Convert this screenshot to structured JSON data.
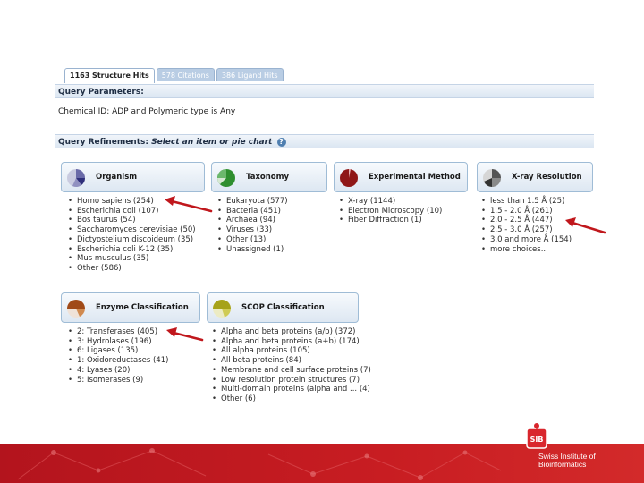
{
  "tabs": [
    {
      "label": "1163 Structure Hits",
      "active": true
    },
    {
      "label": "578 Citations",
      "active": false
    },
    {
      "label": "386 Ligand Hits",
      "active": false
    }
  ],
  "query": {
    "header": "Query Parameters:",
    "text": "Chemical ID: ADP and Polymeric type is Any"
  },
  "refinements": {
    "header_bold": "Query Refinements:",
    "header_italic": "Select an item or pie chart",
    "help_glyph": "?"
  },
  "facets": [
    {
      "title": "Organism",
      "pie_colors": [
        "#3f3f8f",
        "#c9cbe0"
      ],
      "items": [
        "Homo sapiens (254)",
        "Escherichia coli (107)",
        "Bos taurus (54)",
        "Saccharomyces cerevisiae (50)",
        "Dictyostelium discoideum (35)",
        "Escherichia coli K-12 (35)",
        "Mus musculus (35)",
        "Other (586)"
      ]
    },
    {
      "title": "Taxonomy",
      "pie_colors": [
        "#2f8f2f",
        "#d7e8d3"
      ],
      "items": [
        "Eukaryota (577)",
        "Bacteria (451)",
        "Archaea (94)",
        "Viruses (33)",
        "Other (13)",
        "Unassigned (1)"
      ]
    },
    {
      "title": "Experimental Method",
      "pie_colors": [
        "#8f1717",
        "#8f1717"
      ],
      "items": [
        "X-ray (1144)",
        "Electron Microscopy (10)",
        "Fiber Diffraction (1)"
      ]
    },
    {
      "title": "X-ray Resolution",
      "pie_colors": [
        "#555555",
        "#d6d6d6"
      ],
      "items": [
        "less than 1.5 Å (25)",
        "1.5 - 2.0 Å (261)",
        "2.0 - 2.5 Å (447)",
        "2.5 - 3.0 Å (257)",
        "3.0 and more Å (154)",
        "more choices..."
      ]
    },
    {
      "title": "Enzyme Classification",
      "pie_colors": [
        "#a04a18",
        "#efe2d8"
      ],
      "items": [
        "2: Transferases (405)",
        "3: Hydrolases (196)",
        "6: Ligases (135)",
        "1: Oxidoreductases (41)",
        "4: Lyases (20)",
        "5: Isomerases (9)"
      ]
    },
    {
      "title": "SCOP Classification",
      "pie_colors": [
        "#a6a21a",
        "#ecebc4"
      ],
      "items": [
        "Alpha and beta proteins (a/b) (372)",
        "Alpha and beta proteins (a+b) (174)",
        "All alpha proteins (105)",
        "All beta proteins (84)",
        "Membrane and cell surface proteins (7)",
        "Low resolution protein structures (7)",
        "Multi-domain proteins (alpha and ... (4)",
        "Other (6)"
      ]
    }
  ],
  "footer": {
    "logo_text": "SIB",
    "org_line1": "Swiss Institute of",
    "org_line2": "Bioinformatics",
    "bar_color": "#c81d22"
  }
}
